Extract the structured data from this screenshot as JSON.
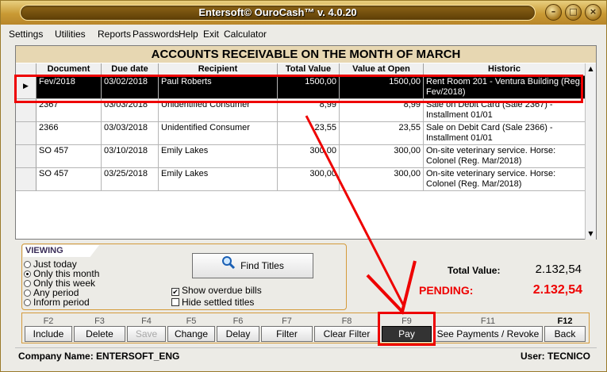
{
  "window": {
    "title": "Entersoft© OuroCash™ v. 4.0.20"
  },
  "menu": [
    "Settings",
    "Utilities",
    "Reports",
    "Passwords",
    "Help",
    "Exit",
    "Calculator"
  ],
  "grid": {
    "title": "ACCOUNTS RECEIVABLE ON THE MONTH OF MARCH",
    "columns": [
      "Document",
      "Due date",
      "Recipient",
      "Total Value",
      "Value at Open",
      "Historic"
    ],
    "rows": [
      [
        "Fev/2018",
        "03/02/2018",
        "Paul Roberts",
        "1500,00",
        "1500,00",
        "Rent Room 201 - Ventura Building (Reg. Fev/2018)"
      ],
      [
        "2367",
        "03/03/2018",
        "Unidentified Consumer",
        "8,99",
        "8,99",
        "Sale on Debit Card (Sale 2367) - Installment 01/01"
      ],
      [
        "2366",
        "03/03/2018",
        "Unidentified Consumer",
        "23,55",
        "23,55",
        "Sale on Debit Card (Sale 2366) - Installment 01/01"
      ],
      [
        "SO 457",
        "03/10/2018",
        "Emily Lakes",
        "300,00",
        "300,00",
        "On-site veterinary service. Horse: Colonel (Reg. Mar/2018)"
      ],
      [
        "SO 457",
        "03/25/2018",
        "Emily Lakes",
        "300,00",
        "300,00",
        "On-site veterinary service. Horse: Colonel (Reg. Mar/2018)"
      ]
    ]
  },
  "viewing": {
    "title": "VIEWING OPTIONS:",
    "options": [
      "Just today",
      "Only this month",
      "Only this week",
      "Any period",
      "Inform period"
    ],
    "selected_index": 1,
    "find_button": "Find Titles",
    "show_overdue": "Show overdue bills",
    "hide_settled": "Hide settled titles"
  },
  "totals": {
    "total_label": "Total Value:",
    "total_value": "2.132,54",
    "pending_label": "PENDING:",
    "pending_value": "2.132,54"
  },
  "fkeys": [
    {
      "key": "F2",
      "label": "Include"
    },
    {
      "key": "F3",
      "label": "Delete"
    },
    {
      "key": "F4",
      "label": "Save"
    },
    {
      "key": "F5",
      "label": "Change"
    },
    {
      "key": "F6",
      "label": "Delay"
    },
    {
      "key": "F7",
      "label": "Filter"
    },
    {
      "key": "F8",
      "label": "Clear Filter"
    },
    {
      "key": "F9",
      "label": "Pay"
    },
    {
      "key": "F11",
      "label": "See Payments / Revoke"
    },
    {
      "key": "F12",
      "label": "Back"
    }
  ],
  "status": {
    "company": "Company Name: ENTERSOFT_ENG",
    "user": "User: TECNICO"
  },
  "colors": {
    "highlight_red": "#e00000",
    "accent_gold": "#c99a34",
    "selected_row": "#000000"
  }
}
